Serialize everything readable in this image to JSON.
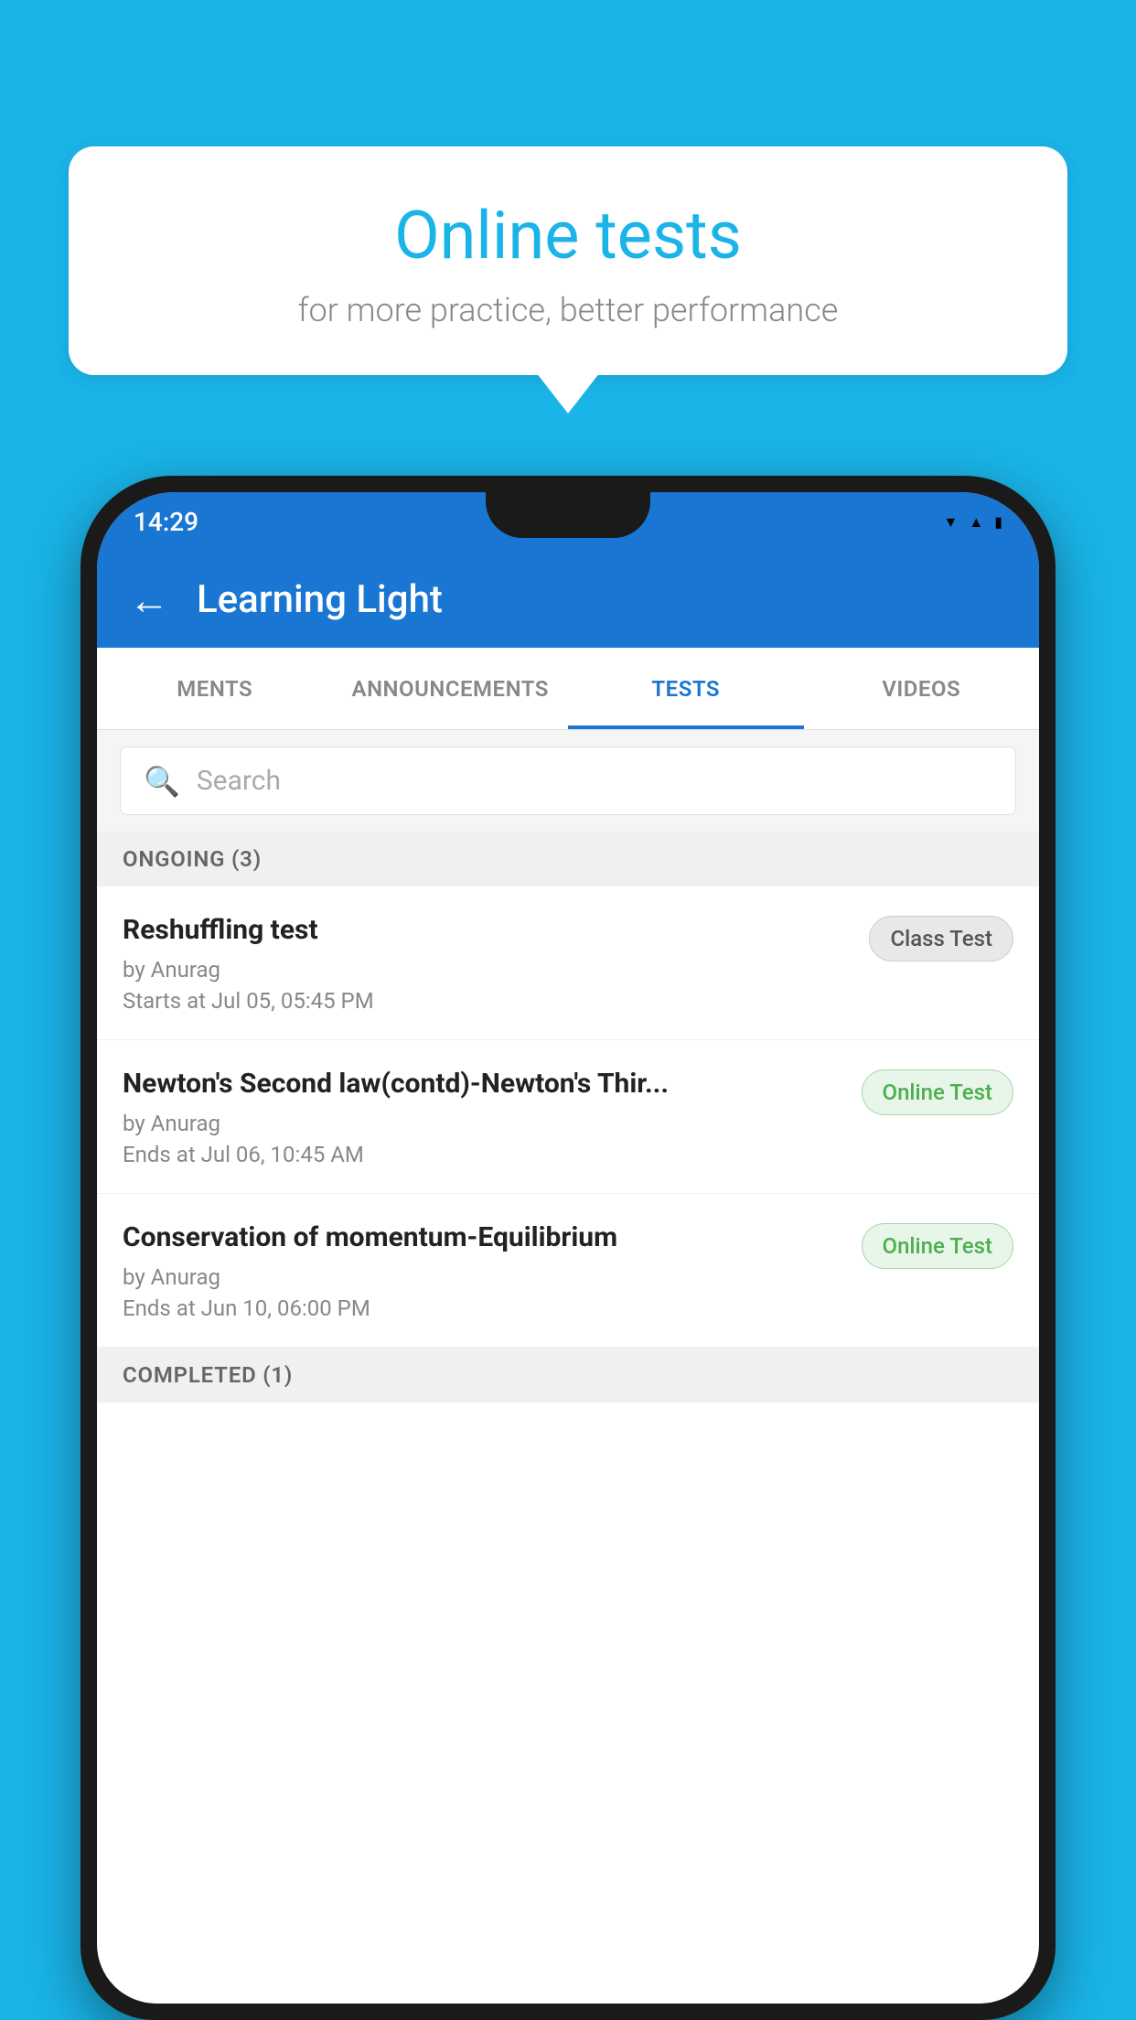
{
  "background_color": "#1ab4e8",
  "bubble": {
    "title": "Online tests",
    "subtitle": "for more practice, better performance"
  },
  "phone": {
    "status_bar": {
      "time": "14:29",
      "wifi": "▼",
      "signal": "▲",
      "battery": "▮"
    },
    "app_bar": {
      "back_label": "←",
      "title": "Learning Light"
    },
    "tabs": [
      {
        "label": "MENTS",
        "active": false
      },
      {
        "label": "ANNOUNCEMENTS",
        "active": false
      },
      {
        "label": "TESTS",
        "active": true
      },
      {
        "label": "VIDEOS",
        "active": false
      }
    ],
    "search": {
      "placeholder": "Search"
    },
    "section_ongoing": {
      "label": "ONGOING (3)"
    },
    "tests": [
      {
        "name": "Reshuffling test",
        "by": "by Anurag",
        "date": "Starts at  Jul 05, 05:45 PM",
        "badge": "Class Test",
        "badge_type": "class"
      },
      {
        "name": "Newton's Second law(contd)-Newton's Thir...",
        "by": "by Anurag",
        "date": "Ends at  Jul 06, 10:45 AM",
        "badge": "Online Test",
        "badge_type": "online"
      },
      {
        "name": "Conservation of momentum-Equilibrium",
        "by": "by Anurag",
        "date": "Ends at  Jun 10, 06:00 PM",
        "badge": "Online Test",
        "badge_type": "online"
      }
    ],
    "section_completed": {
      "label": "COMPLETED (1)"
    }
  }
}
